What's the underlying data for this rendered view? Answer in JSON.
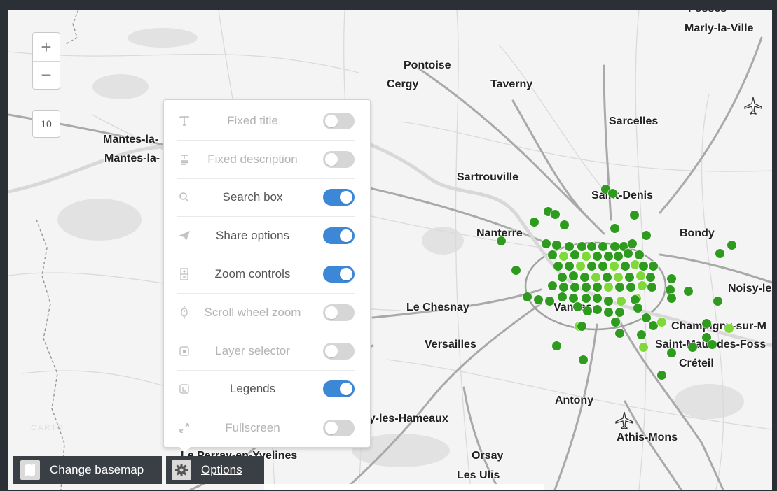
{
  "zoom": {
    "in_label": "+",
    "out_label": "−",
    "level": "10"
  },
  "cities": [
    "Fosses",
    "Marly-la-Ville",
    "Pontoise",
    "Cergy",
    "Taverny",
    "Sarcelles",
    "Mantes-la-",
    "Mantes-la-",
    "Sartrouville",
    "Saint-Denis",
    "Nanterre",
    "Bondy",
    "Noisy-le",
    "Le Chesnay",
    "Vanves",
    "Champigny-sur-M",
    "Versailles",
    "Saint-Maur-des-Foss",
    "Créteil",
    "Antony",
    "ny-les-Hameaux",
    "Athis-Mons",
    "Le Perray-en-Yvelines",
    "Orsay",
    "Les Ulis"
  ],
  "options": [
    {
      "label": "Fixed title",
      "icon": "title-icon",
      "enabled": false
    },
    {
      "label": "Fixed description",
      "icon": "description-icon",
      "enabled": false
    },
    {
      "label": "Search box",
      "icon": "search-icon",
      "enabled": true
    },
    {
      "label": "Share options",
      "icon": "share-icon",
      "enabled": true
    },
    {
      "label": "Zoom controls",
      "icon": "zoom-controls-icon",
      "enabled": true
    },
    {
      "label": "Scroll wheel zoom",
      "icon": "scroll-wheel-icon",
      "enabled": false
    },
    {
      "label": "Layer selector",
      "icon": "layer-selector-icon",
      "enabled": false
    },
    {
      "label": "Legends",
      "icon": "legends-icon",
      "enabled": true
    },
    {
      "label": "Fullscreen",
      "icon": "fullscreen-icon",
      "enabled": false
    }
  ],
  "bottom_bar": {
    "basemap_label": "Change basemap",
    "options_label": "Options"
  },
  "colors": {
    "toggle_on": "#3d88d6",
    "toggle_off": "#d6d6d6",
    "marker": "#2e9b1e",
    "marker_light": "#7fd93a",
    "toolbar": "#3a3f45"
  }
}
